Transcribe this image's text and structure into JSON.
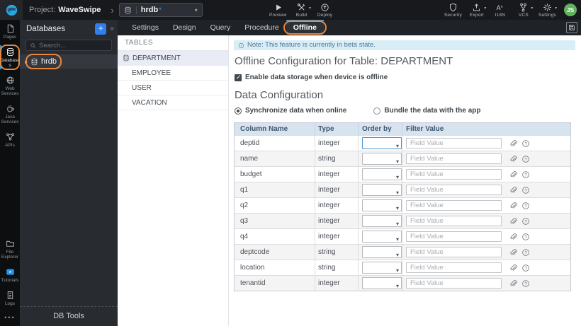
{
  "topbar": {
    "logo_icon": "wavemaker-logo",
    "project_label": "Project:",
    "project_name": "WaveSwipe",
    "breadcrumb_chevron": "›",
    "db_selector": {
      "value": "hrdb",
      "modified_indicator": "*",
      "icon": "database-icon",
      "caret": "▾"
    },
    "build_actions": [
      {
        "label": "Preview",
        "icon": "preview-icon",
        "has_caret": false
      },
      {
        "label": "Build",
        "icon": "build-icon",
        "has_caret": true
      },
      {
        "label": "Deploy",
        "icon": "deploy-icon",
        "has_caret": false
      }
    ],
    "right_actions": [
      {
        "label": "Security",
        "icon": "shield-icon",
        "has_caret": false
      },
      {
        "label": "Export",
        "icon": "export-icon",
        "has_caret": true
      },
      {
        "label": "I18N",
        "icon": "i18n-icon",
        "has_caret": false
      },
      {
        "label": "VCS",
        "icon": "vcs-icon",
        "has_caret": true
      },
      {
        "label": "Settings",
        "icon": "gear-icon",
        "has_caret": true
      }
    ],
    "avatar_initials": "JS"
  },
  "rail": {
    "active": "Databases",
    "top_items": [
      {
        "label": "Pages",
        "icon": "pages-icon"
      },
      {
        "label": "Databases",
        "icon": "database-icon"
      },
      {
        "label": "Web Services",
        "icon": "globe-icon"
      },
      {
        "label": "Java Services",
        "icon": "coffee-icon"
      },
      {
        "label": "APIs",
        "icon": "api-icon"
      }
    ],
    "bottom_items": [
      {
        "label": "File Explorer",
        "icon": "folder-icon"
      },
      {
        "label": "Tutorials",
        "icon": "tutorials-icon"
      },
      {
        "label": "Logs",
        "icon": "logs-icon"
      }
    ],
    "overflow": "•••"
  },
  "db_panel": {
    "title": "Databases",
    "add_button": "+",
    "collapse_chevron": "«",
    "search_icon": "search-icon",
    "search_placeholder": "Search...",
    "selected_item": {
      "label": "hrdb",
      "icon": "database-icon",
      "expander": "▸"
    },
    "footer": "DB Tools"
  },
  "tabs": {
    "active": "Offline",
    "save_icon": "save-icon",
    "items": [
      "Settings",
      "Design",
      "Query",
      "Procedure",
      "Offline"
    ]
  },
  "tables_panel": {
    "title": "TABLES",
    "selected": "DEPARTMENT",
    "item_icon": "database-icon",
    "items": [
      "DEPARTMENT",
      "EMPLOYEE",
      "USER",
      "VACATION"
    ]
  },
  "content": {
    "note_icon": "info-icon",
    "note": "Note: This feature is currently in beta state.",
    "title": "Offline Configuration for Table: DEPARTMENT",
    "enable_label": "Enable data storage when device is offline",
    "enable_checked": true,
    "section_title": "Data Configuration",
    "sync_options": [
      {
        "label": "Synchronize data when online",
        "selected": true
      },
      {
        "label": "Bundle the data with the app",
        "selected": false
      }
    ],
    "table": {
      "headers": [
        "Column Name",
        "Type",
        "Order by",
        "Filter Value"
      ],
      "filter_placeholder": "Field Value",
      "row_icons": [
        "paperclip-icon",
        "question-icon"
      ],
      "rows": [
        {
          "column": "deptid",
          "type": "integer"
        },
        {
          "column": "name",
          "type": "string"
        },
        {
          "column": "budget",
          "type": "integer"
        },
        {
          "column": "q1",
          "type": "integer"
        },
        {
          "column": "q2",
          "type": "integer"
        },
        {
          "column": "q3",
          "type": "integer"
        },
        {
          "column": "q4",
          "type": "integer"
        },
        {
          "column": "deptcode",
          "type": "string"
        },
        {
          "column": "location",
          "type": "string"
        },
        {
          "column": "tenantid",
          "type": "integer"
        }
      ]
    }
  },
  "colors": {
    "accent_blue": "#2f9fe8",
    "annotation_orange": "#e8873b",
    "note_bg": "#d9edf7",
    "table_header_bg": "#d7e3ee",
    "avatar_green": "#62b15c"
  }
}
